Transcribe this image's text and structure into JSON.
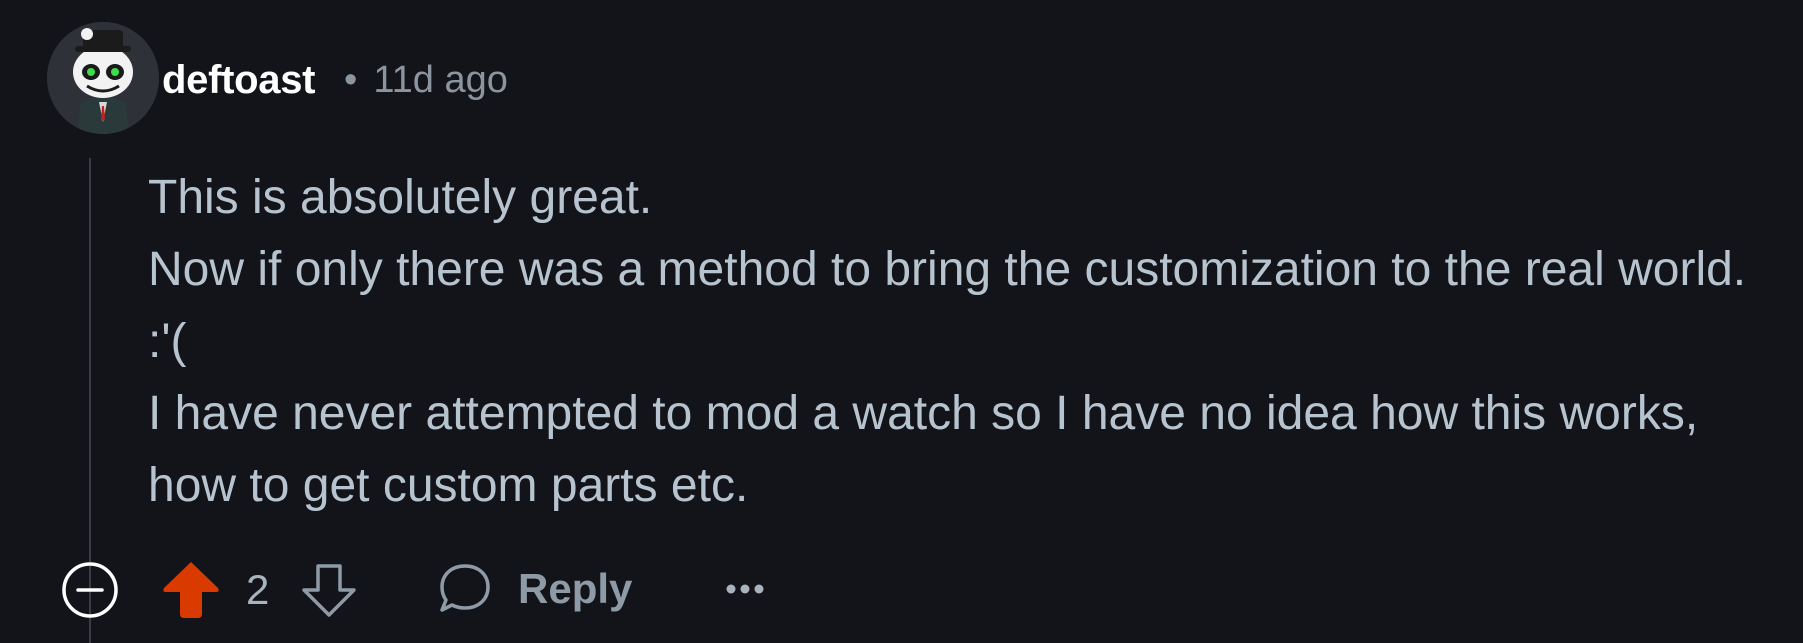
{
  "comment": {
    "author": "deftoast",
    "separator": "•",
    "timestamp": "11d ago",
    "body_lines": [
      "This is absolutely great.",
      "Now if only there was a method to bring the customization to the real world. :'(",
      "I have never attempted to mod a watch so I have no idea how this works, how to get custom parts etc."
    ],
    "score": "2",
    "upvoted": true
  },
  "actions": {
    "reply_label": "Reply"
  },
  "icons": {
    "collapse": "collapse-minus-circle-icon",
    "upvote": "arrow-up-filled-icon",
    "downvote": "arrow-down-outline-icon",
    "reply": "speech-bubble-icon",
    "more": "ellipsis-horizontal-icon"
  },
  "colors": {
    "background": "#121419",
    "upvote_active": "#d93a00",
    "username": "#ffffff",
    "body_text": "#b7c4cf",
    "muted": "#8c959f"
  }
}
